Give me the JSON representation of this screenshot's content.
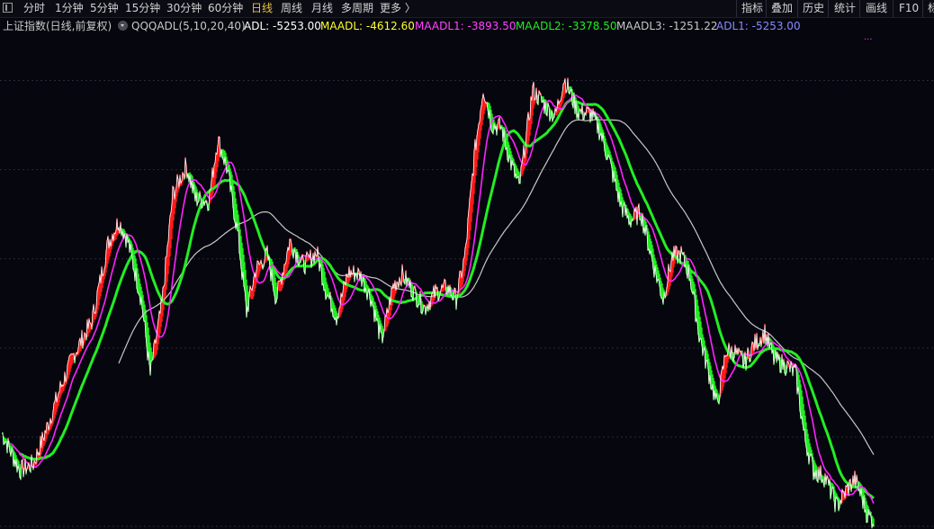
{
  "toolbar": {
    "left_items": [
      {
        "label": "分时",
        "name": "period-tab-fenshi",
        "x": 26
      },
      {
        "label": "1分钟",
        "name": "period-tab-1min",
        "x": 61
      },
      {
        "label": "5分钟",
        "name": "period-tab-5min",
        "x": 100
      },
      {
        "label": "15分钟",
        "name": "period-tab-15min",
        "x": 139
      },
      {
        "label": "30分钟",
        "name": "period-tab-30min",
        "x": 185
      },
      {
        "label": "60分钟",
        "name": "period-tab-60min",
        "x": 231
      },
      {
        "label": "日线",
        "name": "period-tab-daily",
        "x": 279,
        "active": true
      },
      {
        "label": "周线",
        "name": "period-tab-weekly",
        "x": 312
      },
      {
        "label": "月线",
        "name": "period-tab-monthly",
        "x": 346
      },
      {
        "label": "多周期",
        "name": "period-tab-multi",
        "x": 379
      },
      {
        "label": "更多 〉",
        "name": "period-tab-more",
        "x": 422
      }
    ],
    "right_items": [
      {
        "label": "指标",
        "name": "indicator-button",
        "x": 824
      },
      {
        "label": "叠加",
        "name": "overlay-button",
        "x": 857
      },
      {
        "label": "历史",
        "name": "history-button",
        "x": 892
      },
      {
        "label": "统计",
        "name": "stats-button",
        "x": 927
      },
      {
        "label": "画线",
        "name": "draw-line-button",
        "x": 962
      },
      {
        "label": "F10",
        "name": "f10-button",
        "x": 999
      },
      {
        "label": "标",
        "name": "mark-button",
        "x": 1031
      }
    ]
  },
  "legend": {
    "security": "上证指数(日线,前复权)",
    "indicator": "QQQADL(5,10,20,40)",
    "adl": "ADL: -5253.00",
    "maadl": "MAADL: -4612.60",
    "maadl1": "MAADL1: -3893.50",
    "maadl2": "MAADL2: -3378.50",
    "maadl3": "MAADL3: -1251.22",
    "adl1": "ADL1: -5253.00"
  },
  "colors": {
    "background": "#06060e",
    "up": "#ff1a1a",
    "down": "#22ee22",
    "adl": "#ffffff",
    "maadl": "#ffff2a",
    "maadl1": "#ff22ff",
    "maadl2": "#22ee22",
    "maadl3": "#c8c8c8",
    "adl1": "#8a8aff",
    "grid": "#2a2a38"
  },
  "chart_data": {
    "type": "line",
    "title": "QQQADL(5,10,20,40)",
    "ylim": [
      -14000,
      8000
    ],
    "grid": true,
    "x_count": 1000,
    "adl_keypoints": [
      [
        0,
        -9800
      ],
      [
        20,
        -11500
      ],
      [
        35,
        -11200
      ],
      [
        50,
        -9600
      ],
      [
        65,
        -7800
      ],
      [
        80,
        -6300
      ],
      [
        100,
        -4800
      ],
      [
        118,
        -1300
      ],
      [
        130,
        -300
      ],
      [
        140,
        -1200
      ],
      [
        155,
        -3800
      ],
      [
        165,
        -7200
      ],
      [
        178,
        -4000
      ],
      [
        190,
        900
      ],
      [
        205,
        2200
      ],
      [
        215,
        700
      ],
      [
        230,
        600
      ],
      [
        240,
        3400
      ],
      [
        250,
        2100
      ],
      [
        262,
        -800
      ],
      [
        272,
        -4400
      ],
      [
        282,
        -2500
      ],
      [
        295,
        -1800
      ],
      [
        305,
        -3800
      ],
      [
        320,
        -1200
      ],
      [
        335,
        -2300
      ],
      [
        350,
        -1700
      ],
      [
        360,
        -3400
      ],
      [
        372,
        -4600
      ],
      [
        385,
        -2600
      ],
      [
        398,
        -2700
      ],
      [
        410,
        -3700
      ],
      [
        422,
        -5700
      ],
      [
        435,
        -3200
      ],
      [
        445,
        -2700
      ],
      [
        458,
        -3500
      ],
      [
        470,
        -4200
      ],
      [
        482,
        -3500
      ],
      [
        495,
        -3300
      ],
      [
        505,
        -3800
      ],
      [
        515,
        -1800
      ],
      [
        525,
        2600
      ],
      [
        535,
        5700
      ],
      [
        545,
        4000
      ],
      [
        555,
        3900
      ],
      [
        565,
        2400
      ],
      [
        575,
        1200
      ],
      [
        590,
        5600
      ],
      [
        605,
        4800
      ],
      [
        615,
        4400
      ],
      [
        625,
        6100
      ],
      [
        640,
        4600
      ],
      [
        655,
        4500
      ],
      [
        665,
        3700
      ],
      [
        675,
        2400
      ],
      [
        688,
        400
      ],
      [
        698,
        -300
      ],
      [
        710,
        100
      ],
      [
        725,
        -2400
      ],
      [
        735,
        -3800
      ],
      [
        745,
        -1900
      ],
      [
        755,
        -1800
      ],
      [
        765,
        -2800
      ],
      [
        775,
        -5400
      ],
      [
        785,
        -7000
      ],
      [
        795,
        -8600
      ],
      [
        805,
        -6100
      ],
      [
        815,
        -6200
      ],
      [
        825,
        -6700
      ],
      [
        835,
        -5900
      ],
      [
        848,
        -5300
      ],
      [
        858,
        -6500
      ],
      [
        872,
        -6800
      ],
      [
        882,
        -7100
      ],
      [
        892,
        -10000
      ],
      [
        902,
        -11500
      ],
      [
        915,
        -11800
      ],
      [
        928,
        -13100
      ],
      [
        940,
        -12300
      ],
      [
        948,
        -11900
      ],
      [
        955,
        -12600
      ],
      [
        962,
        -13500
      ],
      [
        968,
        -13700
      ]
    ]
  }
}
